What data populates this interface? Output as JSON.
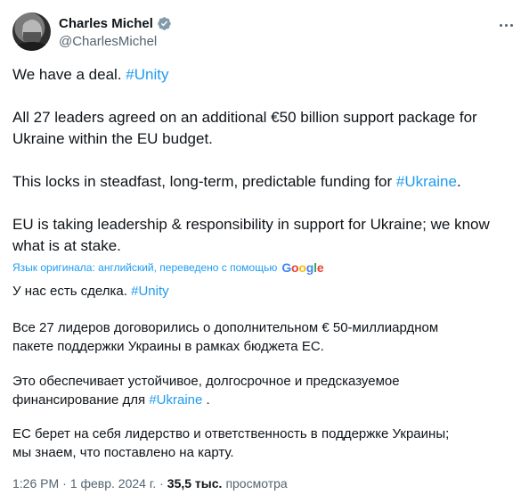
{
  "author": {
    "display_name": "Charles Michel",
    "handle": "@CharlesMichel",
    "verified_icon": "verified-badge-icon",
    "more_icon": "more-options-icon"
  },
  "original": {
    "p1_text": "We have a deal. ",
    "p1_tag": "#Unity",
    "p2_line1": "All 27 leaders agreed on an additional €50 billion support package for",
    "p2_line2": "Ukraine within the EU budget.",
    "p3_text": "This locks in steadfast, long-term, predictable funding for ",
    "p3_tag": "#Ukraine",
    "p3_end": ".",
    "p4_line1": "EU is taking leadership & responsibility in support for Ukraine; we know",
    "p4_line2": "what is at stake."
  },
  "translation_note": {
    "text": "Язык оригинала: английский, переведено с помощью",
    "provider": "Google"
  },
  "translated": {
    "p1_text": "У нас есть сделка. ",
    "p1_tag": "#Unity",
    "p2_line1": "Все 27 лидеров договорились о дополнительном € 50-миллиардном",
    "p2_line2": "пакете поддержки Украины в рамках бюджета ЕС.",
    "p3_line1": "Это обеспечивает устойчивое, долгосрочное и предсказуемое",
    "p3_line2_text": "финансирование для ",
    "p3_tag": "#Ukraine",
    "p3_end": " .",
    "p4_line1": "ЕС берет на себя лидерство и ответственность в поддержке Украины;",
    "p4_line2": "мы знаем, что поставлено на карту."
  },
  "meta": {
    "time": "1:26 PM",
    "dot": "·",
    "date": "1 февр. 2024 г.",
    "views_count": "35,5 тыс.",
    "views_label": "просмотра"
  },
  "colors": {
    "link": "#1d9bf0",
    "text": "#0f1419",
    "secondary": "#536471"
  }
}
